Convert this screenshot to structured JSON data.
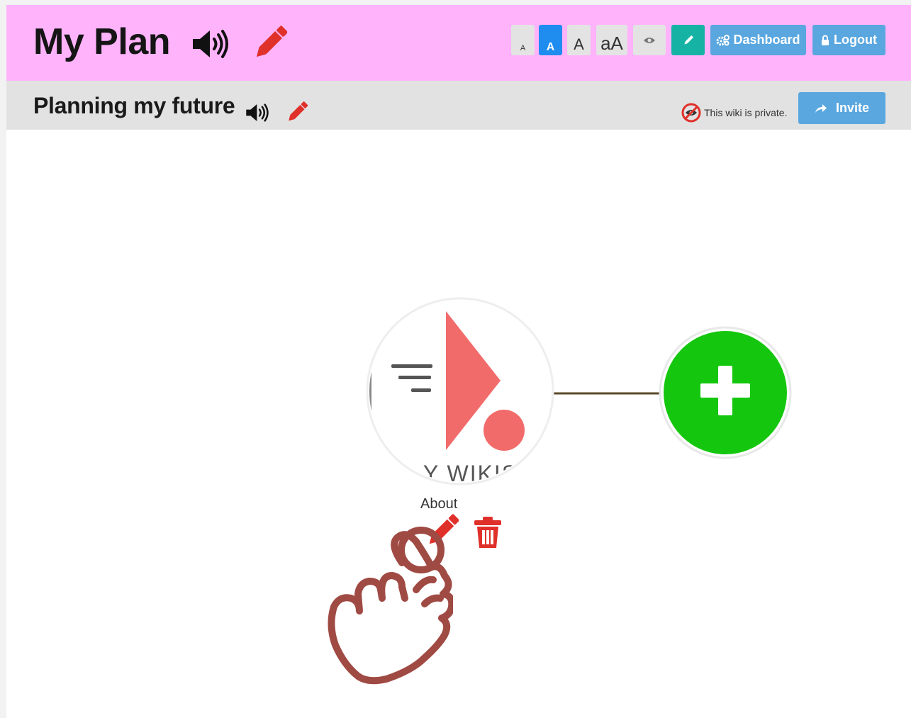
{
  "header": {
    "title": "My Plan",
    "text_size_buttons": [
      {
        "label": "A",
        "active": false
      },
      {
        "label": "A",
        "active": true
      },
      {
        "label": "A",
        "active": false
      },
      {
        "label": "aA",
        "active": false
      }
    ],
    "dashboard_label": "Dashboard",
    "logout_label": "Logout"
  },
  "subheader": {
    "title": "Planning my future",
    "privacy_text": "This wiki is private.",
    "invite_label": "Invite"
  },
  "node": {
    "label": "About",
    "image_caption": "Y WIKIS"
  },
  "icons": [
    "speaker-icon",
    "pencil-icon",
    "eye-icon",
    "gear-icon",
    "lock-icon",
    "hidden-eye-icon",
    "share-arrow-icon",
    "plus-icon",
    "trash-icon",
    "hand-pointer-icon"
  ],
  "colors": {
    "header_bg": "#ffb3fb",
    "subheader_bg": "#e2e2e2",
    "primary_blue": "#1f8cf0",
    "button_blue": "#5aa7e0",
    "teal": "#16b3a4",
    "edit_red": "#e0302a",
    "add_green": "#14c70e",
    "hand_brown": "#a04a44"
  }
}
